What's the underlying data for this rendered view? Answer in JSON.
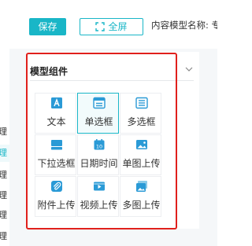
{
  "sidebar": {
    "items": [
      {
        "label": "理"
      },
      {
        "label": "理"
      },
      {
        "label": "理"
      },
      {
        "label": "理"
      },
      {
        "label": "理"
      },
      {
        "label": "理"
      }
    ]
  },
  "toolbar": {
    "save_label": "保存",
    "fullscreen_label": "全屏",
    "model_name_label": "内容模型名称: 专"
  },
  "panel": {
    "title": "模型组件",
    "components": [
      {
        "label": "文本",
        "icon": "text-icon"
      },
      {
        "label": "单选框",
        "icon": "radio-icon",
        "selected": true
      },
      {
        "label": "多选框",
        "icon": "checkbox-icon"
      },
      {
        "label": "下拉选框",
        "icon": "dropdown-icon"
      },
      {
        "label": "日期时间",
        "icon": "calendar-icon"
      },
      {
        "label": "单图上传",
        "icon": "image-icon"
      },
      {
        "label": "附件上传",
        "icon": "attachment-icon"
      },
      {
        "label": "视频上传",
        "icon": "video-icon"
      },
      {
        "label": "多图上传",
        "icon": "images-icon"
      }
    ]
  },
  "colors": {
    "accent": "#19b6c7",
    "highlight_border": "#e0201c"
  }
}
